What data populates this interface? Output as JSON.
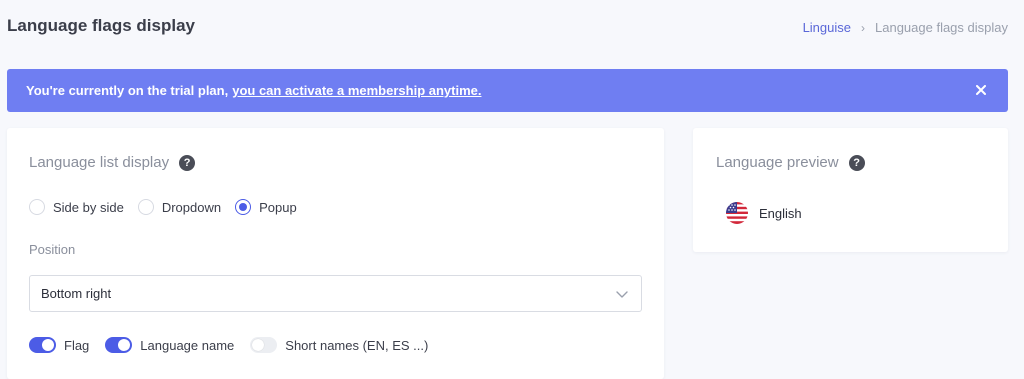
{
  "header": {
    "title": "Language flags display",
    "breadcrumb": {
      "link": "Linguise",
      "separator": "›",
      "current": "Language flags display"
    }
  },
  "alert": {
    "text": "You're currently on the trial plan,",
    "link": "you can activate a membership anytime.",
    "close": "×",
    "color": "#6f7ef2"
  },
  "list_display": {
    "title": "Language list display",
    "help": "?",
    "modes": [
      {
        "label": "Side by side",
        "checked": false
      },
      {
        "label": "Dropdown",
        "checked": false
      },
      {
        "label": "Popup",
        "checked": true
      }
    ],
    "position_label": "Position",
    "position_value": "Bottom right",
    "toggles": [
      {
        "label": "Flag",
        "on": true
      },
      {
        "label": "Language name",
        "on": true
      },
      {
        "label": "Short names (EN, ES ...)",
        "on": false
      }
    ]
  },
  "preview": {
    "title": "Language preview",
    "help": "?",
    "language": "English",
    "flag_icon": "us-flag-icon"
  },
  "colors": {
    "accent": "#4c5ce6",
    "background": "#f7f8fc"
  }
}
